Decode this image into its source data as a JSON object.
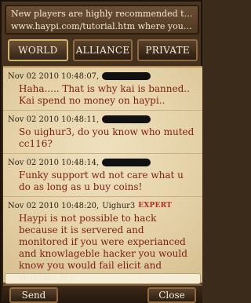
{
  "notice": {
    "line1": "New players are highly recommended to refer to",
    "line2": "www.haypi.com/tutorial.htm where you can le..."
  },
  "tabs": [
    {
      "label": "WORLD"
    },
    {
      "label": "ALLIANCE"
    },
    {
      "label": "PRIVATE"
    }
  ],
  "messages": [
    {
      "timestamp": "Nov 02 2010 10:48:07,",
      "sender": "",
      "badge": "",
      "text": "Haha.....  That is why kai is banned.. Kai spend no money on haypi.."
    },
    {
      "timestamp": "Nov 02 2010 10:48:11,",
      "sender": "",
      "badge": "",
      "text": "So uighur3, do you know who muted cc116?"
    },
    {
      "timestamp": "Nov 02 2010 10:48:14,",
      "sender": "",
      "badge": "",
      "text": "Funky support wd not care what u do as long as u buy coins!"
    },
    {
      "timestamp": "Nov 02 2010 10:48:20,",
      "sender": "Uighur3",
      "badge": "EXPERT",
      "text": "Haypi is not possible to hack because it is servered and monitored if you were experianced and knowlageble hacker you would know you would fail elicit and wouldnt try"
    }
  ],
  "bottom": {
    "send_label": "Send",
    "close_label": "Close",
    "input_value": ""
  }
}
